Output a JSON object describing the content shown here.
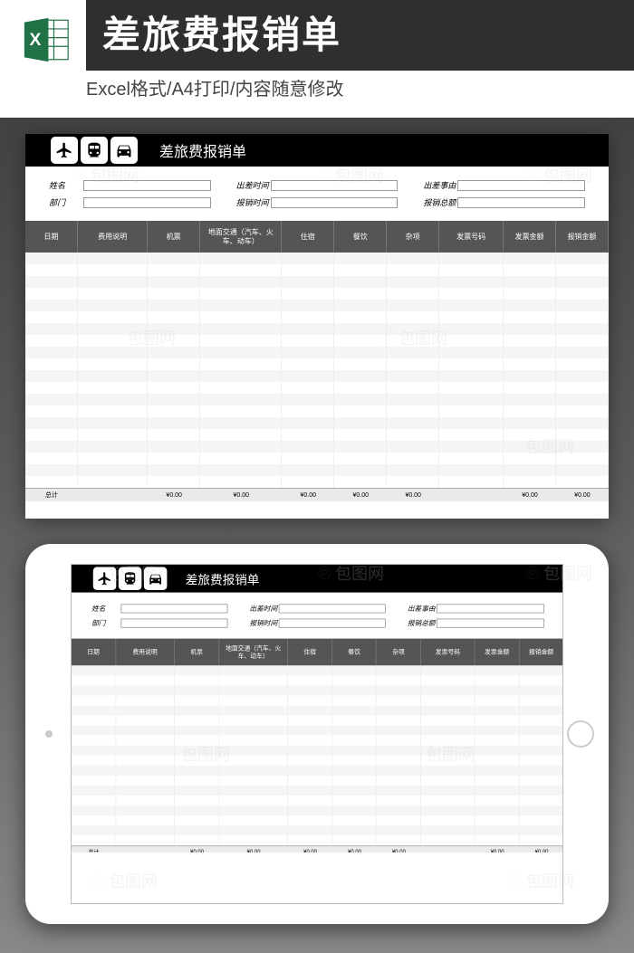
{
  "banner": {
    "title": "差旅费报销单",
    "subtitle": "Excel格式/A4打印/内容随意修改"
  },
  "form": {
    "title": "差旅费报销单",
    "fields": {
      "name": "姓名",
      "dept": "部门",
      "travel_time": "出差时间",
      "submit_time": "报销时间",
      "travel_reason": "出差事由",
      "total_amount": "报销总额"
    },
    "columns": [
      "日期",
      "费用说明",
      "机票",
      "地面交通（汽车、火车、动车）",
      "住宿",
      "餐饮",
      "杂项",
      "发票号码",
      "发票金额",
      "报销金额"
    ],
    "total_label": "总计",
    "zero": "¥0.00"
  },
  "watermark": "包图网"
}
